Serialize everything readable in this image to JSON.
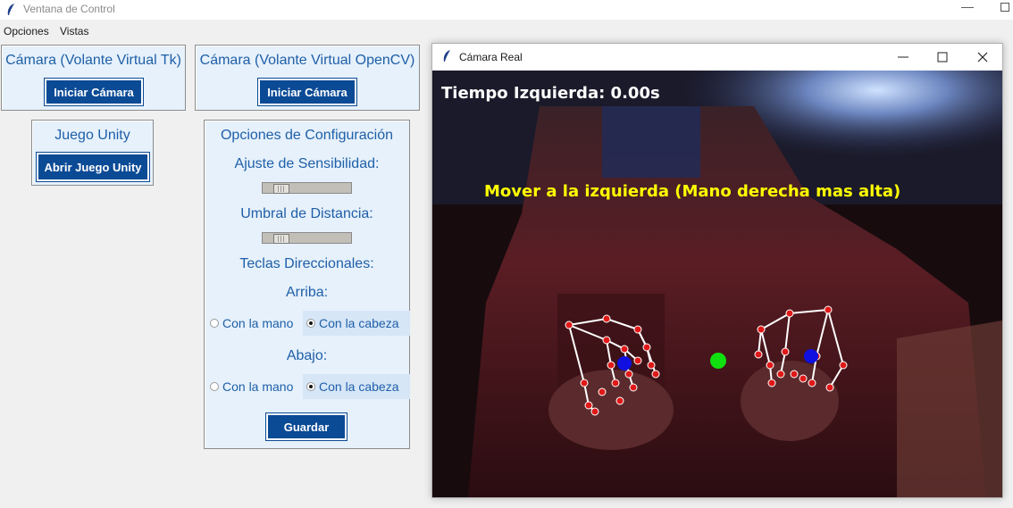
{
  "main_window": {
    "title": "Ventana de Control",
    "minimize_glyph": "—",
    "menu": [
      "Opciones",
      "Vistas"
    ]
  },
  "panels": {
    "cam_tk": {
      "title": "Cámara (Volante Virtual Tk)",
      "button": "Iniciar Cámara"
    },
    "cam_cv": {
      "title": "Cámara (Volante Virtual OpenCV)",
      "button": "Iniciar Cámara"
    },
    "unity": {
      "title": "Juego Unity",
      "button": "Abrir Juego Unity"
    },
    "config": {
      "title": "Opciones de Configuración",
      "sensitivity_label": "Ajuste de Sensibilidad:",
      "sensitivity_level": 0.12,
      "distance_label": "Umbral de Distancia:",
      "distance_level": 0.12,
      "keys_label": "Teclas Direccionales:",
      "up_label": "Arriba:",
      "up_options": [
        "Con la mano",
        "Con la cabeza"
      ],
      "up_selected": "Con la cabeza",
      "down_label": "Abajo:",
      "down_options": [
        "Con la mano",
        "Con la cabeza"
      ],
      "down_selected": "Con la cabeza",
      "save_button": "Guardar"
    }
  },
  "camera_window": {
    "title": "Cámara Real",
    "overlay_timer": "Tiempo Izquierda: 0.00s",
    "overlay_message": "Mover a la izquierda (Mano derecha mas alta)",
    "colors": {
      "overlay_timer": "#ffffff",
      "overlay_message": "#ffff00",
      "landmark": "#e01818",
      "wrist": "#1010e0",
      "center_point": "#10e010"
    }
  }
}
